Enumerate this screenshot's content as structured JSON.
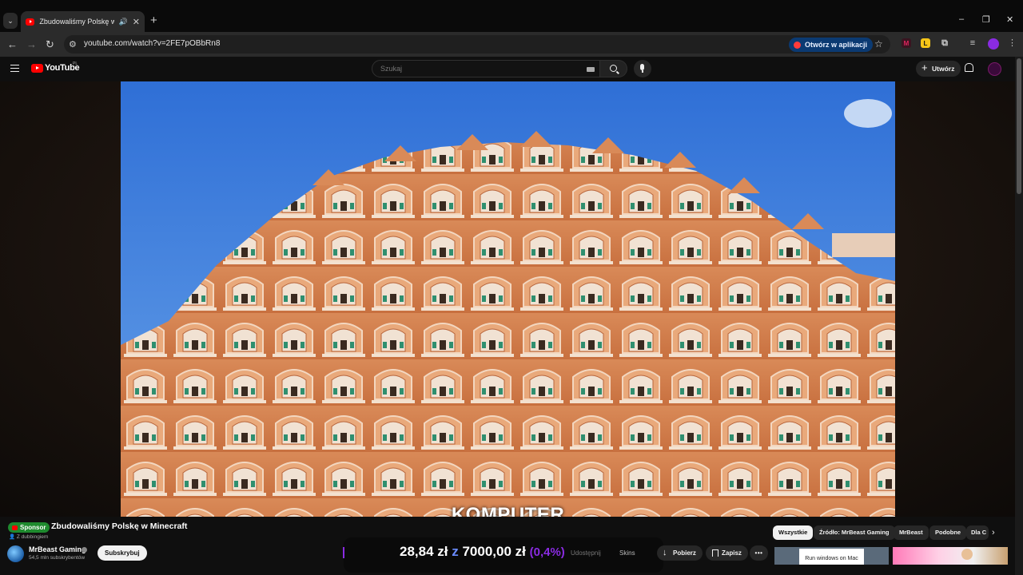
{
  "browser": {
    "tab_title": "Zbudowaliśmy Polskę w Minecraft",
    "new_tab": "+",
    "window_minimize": "–",
    "window_restore": "❐",
    "window_close": "✕",
    "url": "youtube.com/watch?v=2FE7pOBbRn8",
    "open_in_app": "Otwórz w aplikacji",
    "extensions": [
      {
        "label": "M",
        "color": "#e0245e"
      },
      {
        "label": "L",
        "color": "#f5c518"
      }
    ]
  },
  "youtube": {
    "wordmark": "YouTube",
    "region": "PL",
    "search_placeholder": "Szukaj",
    "create_label": "Utwórz"
  },
  "video": {
    "caption": "KOMPUTER"
  },
  "meta": {
    "sponsor_label": "Sponsor",
    "title": "Zbudowaliśmy Polskę w Minecraft",
    "dubbing": "Z dubbingiem",
    "channel_name": "MrBeast Gaming",
    "subscribers": "54,5 mln subskrybentów",
    "subscribe_label": "Subskrybuj"
  },
  "overlay": {
    "price_current": "28,84 zł",
    "price_z": "z",
    "price_target": "7000,00 zł",
    "price_pct": "(0,4%)"
  },
  "actions": {
    "ghost_share": "Udostępnij",
    "skins": "Skins",
    "download": "Pobierz",
    "save": "Zapisz",
    "more": "•••"
  },
  "chips": [
    {
      "label": "Wszystkie",
      "active": true
    },
    {
      "label": "Źródło: MrBeast Gaming",
      "active": false
    },
    {
      "label": "MrBeast",
      "active": false
    },
    {
      "label": "Podobne",
      "active": false
    },
    {
      "label": "Dla C",
      "active": false
    }
  ],
  "thumbnails": {
    "first_text": "Run windows on Mac"
  }
}
